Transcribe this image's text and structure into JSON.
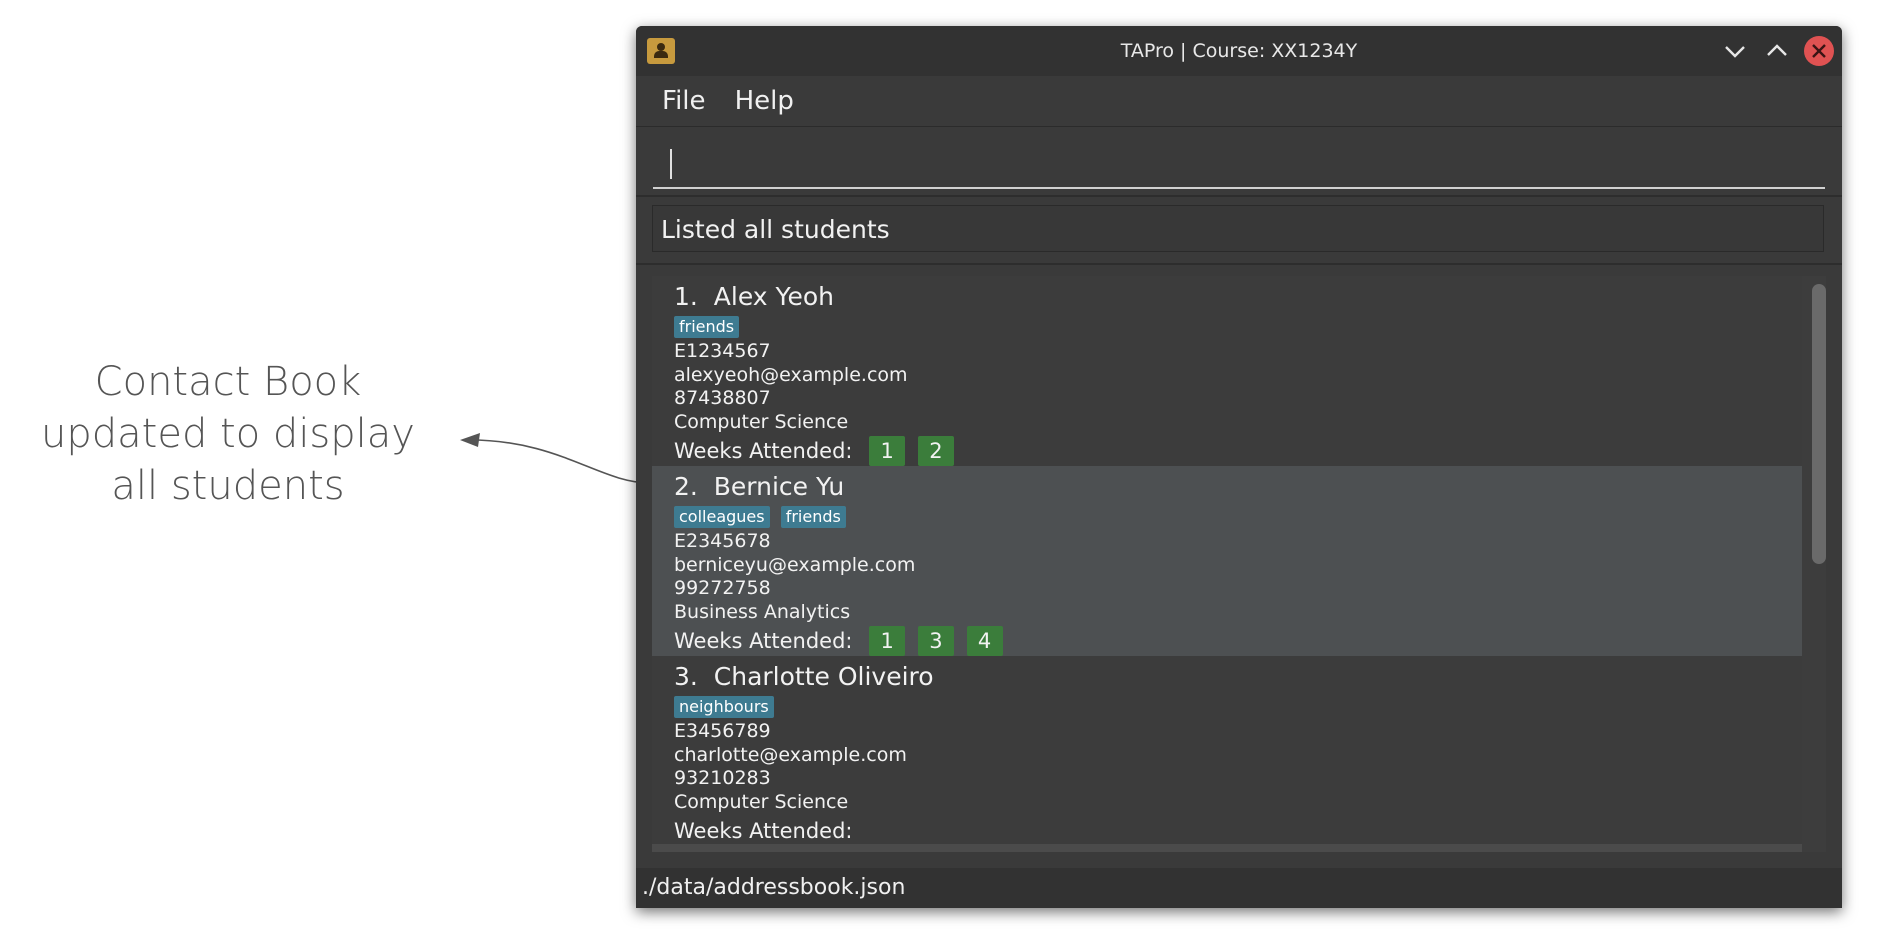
{
  "annotation": {
    "line1": "Contact Book",
    "line2": "updated to display",
    "line3": "all students"
  },
  "window": {
    "title": "TAPro | Course: XX1234Y",
    "icons": {
      "app": "contacts-app-icon",
      "minimize": "chevron-down-icon",
      "maximize": "chevron-up-icon",
      "close": "close-icon"
    }
  },
  "menu": {
    "file": "File",
    "help": "Help"
  },
  "command": {
    "value": ""
  },
  "result": {
    "message": "Listed all students"
  },
  "students": [
    {
      "index": "1.",
      "name": "Alex Yeoh",
      "tags": [
        "friends"
      ],
      "student_id": "E1234567",
      "email": "alexyeoh@example.com",
      "phone": "87438807",
      "major": "Computer Science",
      "weeks_label": "Weeks Attended:",
      "weeks": [
        "1",
        "2"
      ]
    },
    {
      "index": "2.",
      "name": "Bernice Yu",
      "tags": [
        "colleagues",
        "friends"
      ],
      "student_id": "E2345678",
      "email": "berniceyu@example.com",
      "phone": "99272758",
      "major": "Business Analytics",
      "weeks_label": "Weeks Attended:",
      "weeks": [
        "1",
        "3",
        "4"
      ]
    },
    {
      "index": "3.",
      "name": "Charlotte Oliveiro",
      "tags": [
        "neighbours"
      ],
      "student_id": "E3456789",
      "email": "charlotte@example.com",
      "phone": "93210283",
      "major": "Computer Science",
      "weeks_label": "Weeks Attended:",
      "weeks": []
    }
  ],
  "status": {
    "path": "./data/addressbook.json"
  },
  "colors": {
    "tag": "#3e7b91",
    "week": "#3b7d3b",
    "close": "#e05252",
    "selected_row": "#4d5052"
  }
}
